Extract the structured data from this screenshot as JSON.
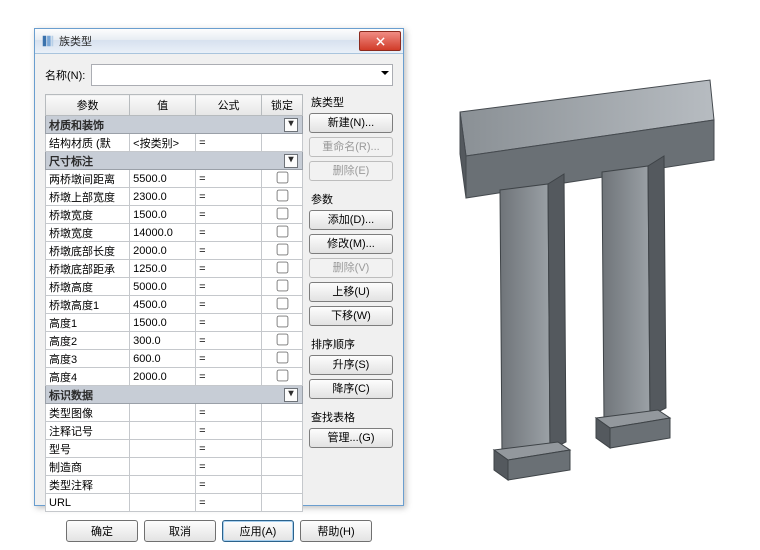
{
  "dialog": {
    "title": "族类型",
    "name_label": "名称(N):",
    "name_value": ""
  },
  "columns": {
    "param": "参数",
    "value": "值",
    "formula": "公式",
    "lock": "锁定"
  },
  "groups": {
    "material": "材质和装饰",
    "dims": "尺寸标注",
    "identity": "标识数据"
  },
  "rows": {
    "material": [
      {
        "p": "结构材质 (默",
        "v": "<按类别>",
        "f": "="
      }
    ],
    "dims": [
      {
        "p": "两桥墩间距离",
        "v": "5500.0",
        "f": "="
      },
      {
        "p": "桥墩上部宽度",
        "v": "2300.0",
        "f": "="
      },
      {
        "p": "桥墩宽度",
        "v": "1500.0",
        "f": "="
      },
      {
        "p": "桥墩宽度",
        "v": "14000.0",
        "f": "="
      },
      {
        "p": "桥墩底部长度",
        "v": "2000.0",
        "f": "="
      },
      {
        "p": "桥墩底部距承",
        "v": "1250.0",
        "f": "="
      },
      {
        "p": "桥墩高度",
        "v": "5000.0",
        "f": "="
      },
      {
        "p": "桥墩高度1",
        "v": "4500.0",
        "f": "="
      },
      {
        "p": "高度1",
        "v": "1500.0",
        "f": "="
      },
      {
        "p": "高度2",
        "v": "300.0",
        "f": "="
      },
      {
        "p": "高度3",
        "v": "600.0",
        "f": "="
      },
      {
        "p": "高度4",
        "v": "2000.0",
        "f": "="
      }
    ],
    "identity": [
      {
        "p": "类型图像",
        "v": "",
        "f": "="
      },
      {
        "p": "注释记号",
        "v": "",
        "f": "="
      },
      {
        "p": "型号",
        "v": "",
        "f": "="
      },
      {
        "p": "制造商",
        "v": "",
        "f": "="
      },
      {
        "p": "类型注释",
        "v": "",
        "f": "="
      },
      {
        "p": "URL",
        "v": "",
        "f": "="
      }
    ]
  },
  "side": {
    "g1_title": "族类型",
    "g1": {
      "new": "新建(N)...",
      "rename": "重命名(R)...",
      "delete": "删除(E)"
    },
    "g2_title": "参数",
    "g2": {
      "add": "添加(D)...",
      "modify": "修改(M)...",
      "remove": "删除(V)",
      "up": "上移(U)",
      "down": "下移(W)"
    },
    "g3_title": "排序顺序",
    "g3": {
      "asc": "升序(S)",
      "desc": "降序(C)"
    },
    "g4_title": "查找表格",
    "g4": {
      "manage": "管理...(G)"
    }
  },
  "buttons": {
    "ok": "确定",
    "cancel": "取消",
    "apply": "应用(A)",
    "help": "帮助(H)"
  }
}
